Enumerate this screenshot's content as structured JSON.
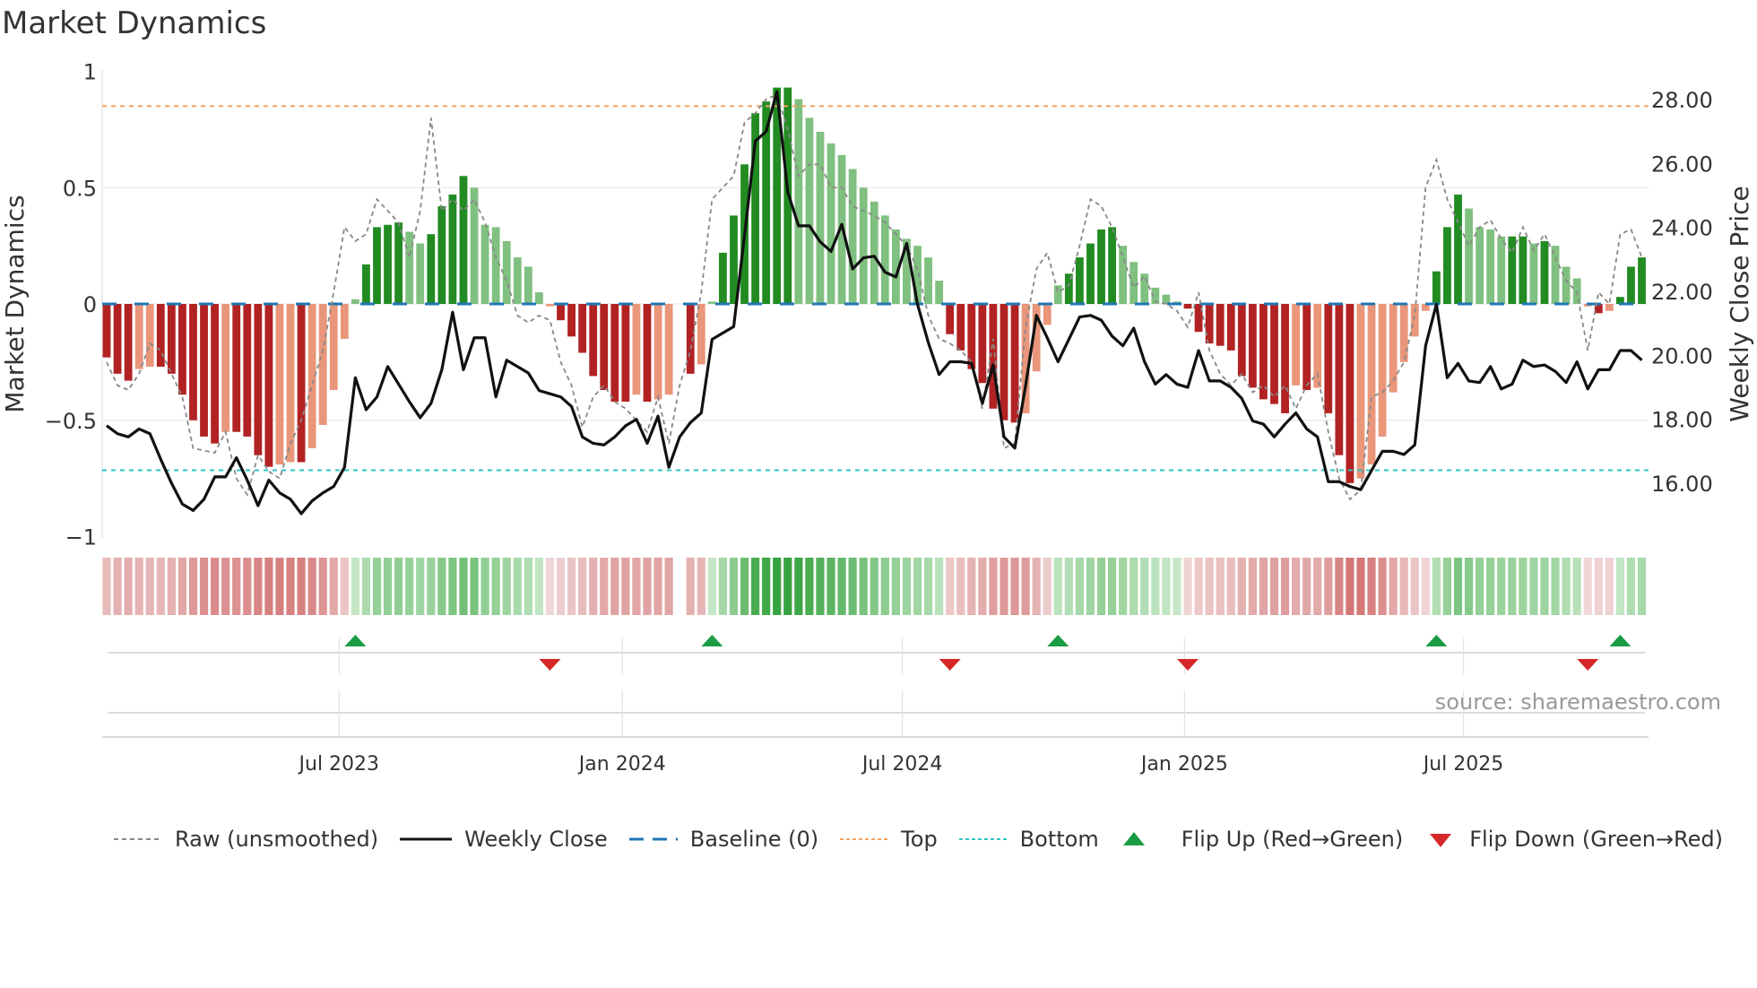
{
  "chart_data": {
    "type": "bar",
    "title": "Market Dynamics",
    "ylabel": "Market Dynamics",
    "y2label": "Weekly Close Price",
    "ylim": [
      -1,
      1
    ],
    "y2lim": [
      16,
      28
    ],
    "yticks": [
      {
        "v": 1,
        "label": "1"
      },
      {
        "v": 0.5,
        "label": "0.5"
      },
      {
        "v": 0,
        "label": "0"
      },
      {
        "v": -0.5,
        "label": "−0.5"
      },
      {
        "v": -1,
        "label": "−1"
      }
    ],
    "y2ticks": [
      {
        "v": 28,
        "label": "28.00"
      },
      {
        "v": 26,
        "label": "26.00"
      },
      {
        "v": 24,
        "label": "24.00"
      },
      {
        "v": 22,
        "label": "22.00"
      },
      {
        "v": 20,
        "label": "20.00"
      },
      {
        "v": 18,
        "label": "18.00"
      },
      {
        "v": 16,
        "label": "16.00"
      }
    ],
    "xticks": [
      {
        "week": 21.5,
        "label": "Jul 2023"
      },
      {
        "week": 47.7,
        "label": "Jan 2024"
      },
      {
        "week": 73.6,
        "label": "Jul 2024"
      },
      {
        "week": 99.7,
        "label": "Jan 2025"
      },
      {
        "week": 125.5,
        "label": "Jul 2025"
      }
    ],
    "top_level": 0.85,
    "bottom_level": -0.715,
    "baseline": 0,
    "dynamics": [
      -0.23,
      -0.3,
      -0.33,
      -0.28,
      -0.27,
      -0.27,
      -0.3,
      -0.39,
      -0.5,
      -0.57,
      -0.6,
      -0.55,
      -0.55,
      -0.57,
      -0.65,
      -0.7,
      -0.69,
      -0.68,
      -0.68,
      -0.62,
      -0.52,
      -0.37,
      -0.15,
      0.02,
      0.17,
      0.33,
      0.34,
      0.35,
      0.31,
      0.26,
      0.3,
      0.42,
      0.47,
      0.55,
      0.5,
      0.34,
      0.33,
      0.27,
      0.2,
      0.16,
      0.05,
      -0.01,
      -0.07,
      -0.14,
      -0.21,
      -0.31,
      -0.37,
      -0.42,
      -0.42,
      -0.39,
      -0.42,
      -0.41,
      -0.39,
      null,
      -0.3,
      -0.26,
      0.01,
      0.22,
      0.38,
      0.6,
      0.82,
      0.87,
      0.93,
      0.93,
      0.88,
      0.8,
      0.74,
      0.69,
      0.64,
      0.58,
      0.5,
      0.44,
      0.38,
      0.32,
      0.28,
      0.25,
      0.2,
      0.1,
      -0.13,
      -0.2,
      -0.28,
      -0.34,
      -0.45,
      -0.5,
      -0.51,
      -0.47,
      -0.29,
      -0.09,
      0.08,
      0.13,
      0.2,
      0.26,
      0.32,
      0.33,
      0.25,
      0.18,
      0.13,
      0.07,
      0.04,
      0.01,
      -0.02,
      -0.12,
      -0.17,
      -0.18,
      -0.2,
      -0.31,
      -0.36,
      -0.41,
      -0.43,
      -0.47,
      -0.35,
      -0.37,
      -0.36,
      -0.47,
      -0.65,
      -0.77,
      -0.75,
      -0.69,
      -0.57,
      -0.38,
      -0.25,
      -0.14,
      -0.03,
      0.14,
      0.33,
      0.47,
      0.41,
      0.33,
      0.32,
      0.29,
      0.29,
      0.29,
      0.26,
      0.27,
      0.25,
      0.16,
      0.11,
      -0.01,
      -0.04,
      -0.03,
      0.03,
      0.16,
      0.2
    ],
    "raw": [
      -0.25,
      -0.35,
      -0.37,
      -0.3,
      -0.17,
      -0.2,
      -0.3,
      -0.4,
      -0.62,
      -0.63,
      -0.64,
      -0.55,
      -0.75,
      -0.82,
      -0.65,
      -0.72,
      -0.75,
      -0.6,
      -0.5,
      -0.35,
      -0.2,
      0.05,
      0.33,
      0.27,
      0.3,
      0.45,
      0.4,
      0.35,
      0.2,
      0.4,
      0.8,
      0.4,
      0.45,
      0.4,
      0.45,
      0.35,
      0.2,
      0.1,
      -0.05,
      -0.08,
      -0.05,
      -0.07,
      -0.25,
      -0.35,
      -0.53,
      -0.4,
      -0.35,
      -0.42,
      -0.45,
      -0.5,
      -0.55,
      -0.4,
      -0.6,
      -0.35,
      -0.2,
      0.05,
      0.45,
      0.5,
      0.55,
      0.78,
      0.82,
      0.88,
      0.9,
      0.75,
      0.55,
      0.6,
      0.6,
      0.5,
      0.5,
      0.42,
      0.4,
      0.38,
      0.35,
      0.3,
      0.25,
      0.15,
      -0.05,
      -0.15,
      -0.17,
      -0.2,
      -0.25,
      -0.45,
      -0.15,
      -0.62,
      -0.6,
      -0.1,
      0.15,
      0.22,
      0.05,
      0.08,
      0.25,
      0.45,
      0.42,
      0.33,
      0.2,
      0.07,
      0.12,
      0.01,
      0.0,
      -0.03,
      -0.1,
      0.05,
      -0.2,
      -0.3,
      -0.35,
      -0.3,
      -0.38,
      -0.35,
      -0.4,
      -0.35,
      -0.45,
      -0.35,
      -0.3,
      -0.55,
      -0.75,
      -0.84,
      -0.8,
      -0.4,
      -0.38,
      -0.33,
      -0.25,
      -0.05,
      0.5,
      0.62,
      0.45,
      0.35,
      0.25,
      0.33,
      0.36,
      0.28,
      0.22,
      0.33,
      0.23,
      0.3,
      0.2,
      0.1,
      0.05,
      -0.2,
      0.05,
      0.0,
      0.3,
      0.32,
      0.2
    ],
    "close": [
      17.8,
      17.55,
      17.45,
      17.7,
      17.55,
      16.75,
      16.0,
      15.35,
      15.15,
      15.5,
      16.2,
      16.2,
      16.8,
      16.1,
      15.3,
      16.1,
      15.7,
      15.5,
      15.05,
      15.45,
      15.7,
      15.9,
      16.5,
      19.3,
      18.3,
      18.7,
      19.65,
      19.1,
      18.55,
      18.05,
      18.5,
      19.55,
      21.35,
      19.55,
      20.55,
      20.55,
      18.7,
      19.85,
      19.65,
      19.45,
      18.9,
      18.8,
      18.7,
      18.4,
      17.45,
      17.25,
      17.2,
      17.45,
      17.8,
      18.0,
      17.25,
      18.1,
      16.5,
      17.45,
      17.9,
      18.2,
      20.5,
      20.7,
      20.9,
      23.75,
      26.7,
      27.0,
      28.25,
      25.1,
      24.05,
      24.05,
      23.55,
      23.25,
      24.1,
      22.7,
      23.05,
      23.1,
      22.6,
      22.45,
      23.5,
      21.6,
      20.4,
      19.4,
      19.8,
      19.8,
      19.75,
      18.5,
      19.7,
      17.45,
      17.1,
      19.05,
      21.25,
      20.55,
      19.8,
      20.5,
      21.2,
      21.25,
      21.1,
      20.6,
      20.3,
      20.85,
      19.8,
      19.1,
      19.4,
      19.1,
      19.0,
      20.15,
      19.2,
      19.2,
      19.0,
      18.65,
      17.95,
      17.85,
      17.45,
      17.85,
      18.2,
      17.7,
      17.45,
      16.05,
      16.05,
      15.9,
      15.8,
      16.4,
      17.0,
      17.0,
      16.9,
      17.2,
      20.3,
      21.6,
      19.3,
      19.75,
      19.2,
      19.15,
      19.65,
      18.95,
      19.1,
      19.85,
      19.65,
      19.7,
      19.5,
      19.15,
      19.8,
      18.95,
      19.55,
      19.55,
      20.15,
      20.15,
      19.85
    ],
    "legend": [
      "Raw (unsmoothed)",
      "Weekly Close",
      "Baseline (0)",
      "Top",
      "Bottom",
      "Flip Up (Red→Green)",
      "Flip Down (Green→Red)"
    ],
    "legend_placement": "bottom"
  },
  "colors": {
    "pos_strong": "#228b22",
    "pos_weak": "#80c080",
    "neg_strong": "#b22222",
    "neg_weak": "#e9967a",
    "top": "#f4a460",
    "bottom": "#2ec4c4",
    "baseline": "#1f77b4",
    "flip_up": "#1a9c45",
    "flip_down": "#d62728"
  },
  "source": "source: sharemaestro.com"
}
